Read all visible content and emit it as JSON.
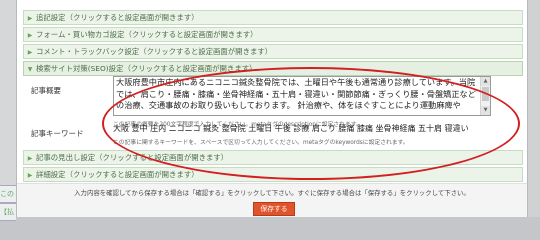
{
  "bars": {
    "b1": "追記設定（クリックすると設定画面が開きます）",
    "b2": "フォーム・買い物カゴ設定（クリックすると設定画面が開きます）",
    "b3": "コメント・トラックバック設定（クリックすると設定画面が開きます）",
    "b4": "検索サイト対策(SEO)設定（クリックすると設定画面が開きます）",
    "b5": "記事の見出し設定（クリックすると設定画面が開きます）",
    "b6": "詳細設定（クリックすると設定画面が開きます）"
  },
  "seo": {
    "summary_label": "記事概要",
    "summary_value": "大阪府豊中市庄内にあるニコニコ鍼灸整骨院では、土曜日や午後も通常通り診療しています。当院では、肩こり・腰痛・膝痛・坐骨神経痛・五十肩・寝違い・関節節痛・ぎっくり腰・骨盤矯正などの治療、交通事故のお取り扱いもしております。 針治療や、体をほぐすことにより運動麻痺や",
    "summary_note": "この記事の概要を200文字程度で入力してください。metaタグのdescriptionに設定されます。",
    "keyword_label": "記事キーワード",
    "keyword_value": "大阪 豊中 庄内 ニコニコ 鍼灸 整骨院 土曜日 午後 診療 肩こり 腰痛 膝痛 坐骨神経痛 五十肩 寝違い",
    "keyword_note": "この記事に関するキーワードを、スペースで区切って入力してください。metaタグのkeywordsに設定されます。"
  },
  "footer": {
    "message": "入力内容を確認してから保存する場合は「確認する」をクリックして下さい。すぐに保存する場合は「保存する」をクリックして下さい。",
    "save_label": "保存する"
  },
  "left_tabs": [
    "この",
    "【払"
  ]
}
